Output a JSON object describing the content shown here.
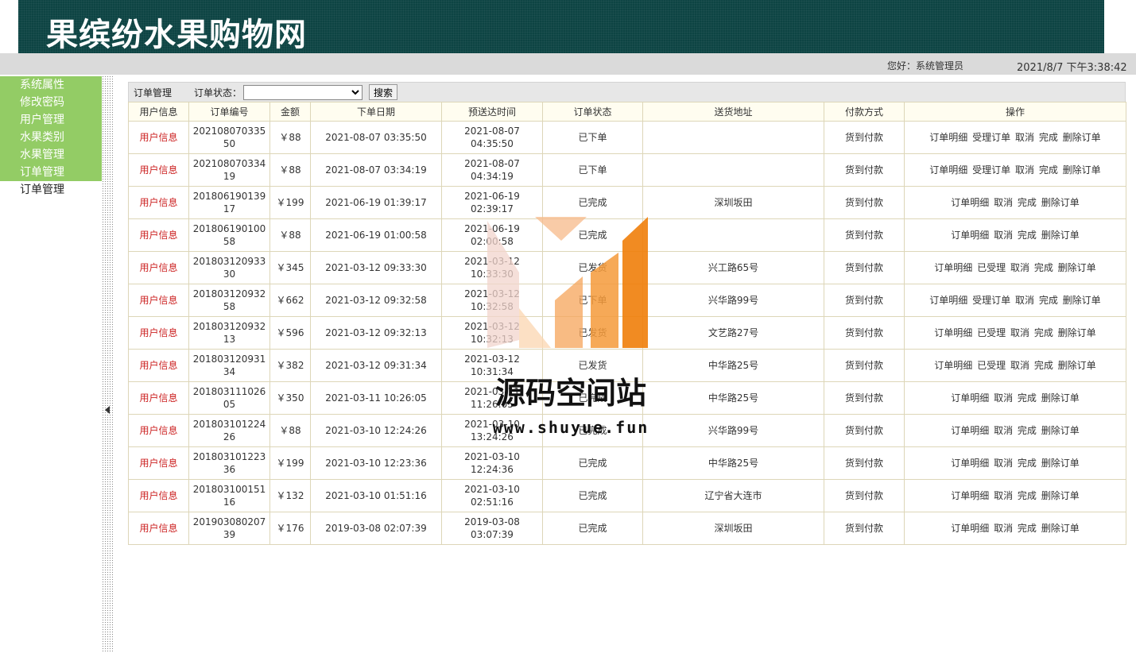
{
  "header": {
    "site_title": "果缤纷水果购物网"
  },
  "topbar": {
    "greeting": "您好：系统管理员",
    "datetime": "2021/8/7 下午3:38:42"
  },
  "sidebar": {
    "items": [
      {
        "label": "系统属性"
      },
      {
        "label": "修改密码"
      },
      {
        "label": "用户管理"
      },
      {
        "label": "水果类别"
      },
      {
        "label": "水果管理"
      },
      {
        "label": "订单管理"
      },
      {
        "label": "订单管理"
      }
    ]
  },
  "toolbar": {
    "section_label": "订单管理",
    "status_label": "订单状态：",
    "status_value": "",
    "search_label": "搜索"
  },
  "table": {
    "columns": [
      "用户信息",
      "订单编号",
      "金额",
      "下单日期",
      "预送达时间",
      "订单状态",
      "送货地址",
      "付款方式",
      "操作"
    ],
    "rows": [
      {
        "user": "用户信息",
        "order_no": "20210807033550",
        "amount": "￥88",
        "order_date": "2021-08-07 03:35:50",
        "eta": "2021-08-07 04:35:50",
        "status": "已下单",
        "address": "",
        "payment": "货到付款",
        "actions": [
          "订单明细",
          "受理订单",
          "取消",
          "完成",
          "删除订单"
        ]
      },
      {
        "user": "用户信息",
        "order_no": "20210807033419",
        "amount": "￥88",
        "order_date": "2021-08-07 03:34:19",
        "eta": "2021-08-07 04:34:19",
        "status": "已下单",
        "address": "",
        "payment": "货到付款",
        "actions": [
          "订单明细",
          "受理订单",
          "取消",
          "完成",
          "删除订单"
        ]
      },
      {
        "user": "用户信息",
        "order_no": "20180619013917",
        "amount": "￥199",
        "order_date": "2021-06-19 01:39:17",
        "eta": "2021-06-19 02:39:17",
        "status": "已完成",
        "address": "深圳坂田",
        "payment": "货到付款",
        "actions": [
          "订单明细",
          "取消",
          "完成",
          "删除订单"
        ]
      },
      {
        "user": "用户信息",
        "order_no": "20180619010058",
        "amount": "￥88",
        "order_date": "2021-06-19 01:00:58",
        "eta": "2021-06-19 02:00:58",
        "status": "已完成",
        "address": "",
        "payment": "货到付款",
        "actions": [
          "订单明细",
          "取消",
          "完成",
          "删除订单"
        ]
      },
      {
        "user": "用户信息",
        "order_no": "20180312093330",
        "amount": "￥345",
        "order_date": "2021-03-12 09:33:30",
        "eta": "2021-03-12 10:33:30",
        "status": "已发货",
        "address": "兴工路65号",
        "payment": "货到付款",
        "actions": [
          "订单明细",
          "已受理",
          "取消",
          "完成",
          "删除订单"
        ]
      },
      {
        "user": "用户信息",
        "order_no": "20180312093258",
        "amount": "￥662",
        "order_date": "2021-03-12 09:32:58",
        "eta": "2021-03-12 10:32:58",
        "status": "已下单",
        "address": "兴华路99号",
        "payment": "货到付款",
        "actions": [
          "订单明细",
          "受理订单",
          "取消",
          "完成",
          "删除订单"
        ]
      },
      {
        "user": "用户信息",
        "order_no": "20180312093213",
        "amount": "￥596",
        "order_date": "2021-03-12 09:32:13",
        "eta": "2021-03-12 10:32:13",
        "status": "已发货",
        "address": "文艺路27号",
        "payment": "货到付款",
        "actions": [
          "订单明细",
          "已受理",
          "取消",
          "完成",
          "删除订单"
        ]
      },
      {
        "user": "用户信息",
        "order_no": "20180312093134",
        "amount": "￥382",
        "order_date": "2021-03-12 09:31:34",
        "eta": "2021-03-12 10:31:34",
        "status": "已发货",
        "address": "中华路25号",
        "payment": "货到付款",
        "actions": [
          "订单明细",
          "已受理",
          "取消",
          "完成",
          "删除订单"
        ]
      },
      {
        "user": "用户信息",
        "order_no": "20180311102605",
        "amount": "￥350",
        "order_date": "2021-03-11 10:26:05",
        "eta": "2021-03-11 11:26:05",
        "status": "已完成",
        "address": "中华路25号",
        "payment": "货到付款",
        "actions": [
          "订单明细",
          "取消",
          "完成",
          "删除订单"
        ]
      },
      {
        "user": "用户信息",
        "order_no": "20180310122426",
        "amount": "￥88",
        "order_date": "2021-03-10 12:24:26",
        "eta": "2021-03-10 13:24:26",
        "status": "已完成",
        "address": "兴华路99号",
        "payment": "货到付款",
        "actions": [
          "订单明细",
          "取消",
          "完成",
          "删除订单"
        ]
      },
      {
        "user": "用户信息",
        "order_no": "20180310122336",
        "amount": "￥199",
        "order_date": "2021-03-10 12:23:36",
        "eta": "2021-03-10 12:24:36",
        "status": "已完成",
        "address": "中华路25号",
        "payment": "货到付款",
        "actions": [
          "订单明细",
          "取消",
          "完成",
          "删除订单"
        ]
      },
      {
        "user": "用户信息",
        "order_no": "20180310015116",
        "amount": "￥132",
        "order_date": "2021-03-10 01:51:16",
        "eta": "2021-03-10 02:51:16",
        "status": "已完成",
        "address": "辽宁省大连市",
        "payment": "货到付款",
        "actions": [
          "订单明细",
          "取消",
          "完成",
          "删除订单"
        ]
      },
      {
        "user": "用户信息",
        "order_no": "20190308020739",
        "amount": "￥176",
        "order_date": "2019-03-08 02:07:39",
        "eta": "2019-03-08 03:07:39",
        "status": "已完成",
        "address": "深圳坂田",
        "payment": "货到付款",
        "actions": [
          "订单明细",
          "取消",
          "完成",
          "删除订单"
        ]
      }
    ]
  },
  "watermark": {
    "text": "源码空间站",
    "url": "www.shuyue.fun"
  }
}
